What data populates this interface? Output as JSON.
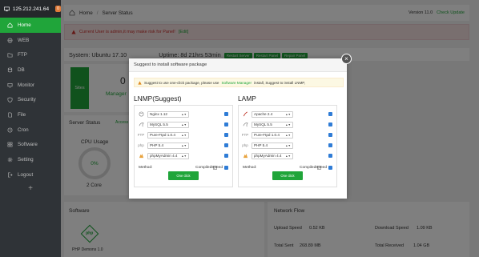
{
  "sidebar": {
    "ip": "125.212.241.64",
    "badge": "0",
    "items": [
      {
        "label": "Home"
      },
      {
        "label": "WEB"
      },
      {
        "label": "FTP"
      },
      {
        "label": "DB"
      },
      {
        "label": "Monitor"
      },
      {
        "label": "Security"
      },
      {
        "label": "File"
      },
      {
        "label": "Cron"
      },
      {
        "label": "Software"
      },
      {
        "label": "Setting"
      },
      {
        "label": "Logout"
      }
    ],
    "add": "+"
  },
  "topbar": {
    "home": "Home",
    "sep": "/",
    "page": "Server Status",
    "version": "Version 11.0",
    "check_update": "Check Update"
  },
  "alert": {
    "text": "Current User is admin,it may make risk for Panel!",
    "edit": "[Edit]"
  },
  "sysbar": {
    "system": "System: Ubuntu 17.10",
    "uptime": "Uptime: 8d 21hrs 53min",
    "btn_restart_server": "Restart Server",
    "btn_restart_panel": "Restart Panel",
    "btn_repair_panel": "Repair Panel"
  },
  "background": {
    "sites": "Sites",
    "sites_value": "0",
    "manager": "Manager",
    "server_status": "Server Status",
    "access": "Access",
    "cpu_usage": "CPU Usage",
    "cpu_value": "0%",
    "cores": "2 Core",
    "software": "Software",
    "php_label": "php",
    "php_demons": "PHP Demons 1.0",
    "network_flow": "Network Flow",
    "upload_speed_label": "Upload Speed",
    "upload_speed": "0.52 KB",
    "download_speed_label": "Download Speed",
    "download_speed": "1.09 KB",
    "total_sent_label": "Total Sent",
    "total_sent": "268.89 MB",
    "total_received_label": "Total Received",
    "total_received": "1.04 GB"
  },
  "modal": {
    "title": "Suggest to install software package",
    "close": "×",
    "notice_pre": "Suggest to use one-click package, please use",
    "notice_link": "Software Manager",
    "notice_post": "install,  Suggest to install LNMP,",
    "lnmp": {
      "title": "LNMP(Suggest)",
      "rows": [
        {
          "icon": "nginx-icon",
          "value": "Nginx 1.12"
        },
        {
          "icon": "mysql-icon",
          "value": "MySQL 5.5"
        },
        {
          "icon": "ftp-icon",
          "value": "Pure-Ftpd 1.0.4"
        },
        {
          "icon": "php-icon",
          "value": "PHP 5.4"
        },
        {
          "icon": "phpmyadmin-icon",
          "value": "phpMyAdmin 4.4"
        }
      ],
      "method": "Method:",
      "compiled": "Compiled",
      "speed": "Speed",
      "button": "One click"
    },
    "lamp": {
      "title": "LAMP",
      "rows": [
        {
          "icon": "apache-icon",
          "value": "Apache 2.4"
        },
        {
          "icon": "mysql-icon",
          "value": "MySQL 5.5"
        },
        {
          "icon": "ftp-icon",
          "value": "Pure-Ftpd 1.0.4"
        },
        {
          "icon": "php-icon",
          "value": "PHP 5.4"
        },
        {
          "icon": "phpmyadmin-icon",
          "value": "phpMyAdmin 4.4"
        }
      ],
      "method": "Method:",
      "compiled": "Compiled",
      "speed": "Speed",
      "button": "One click"
    }
  }
}
